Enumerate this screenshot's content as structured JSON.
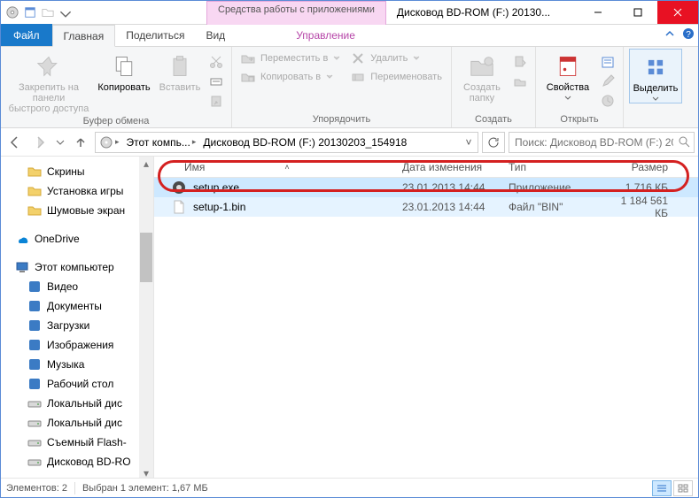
{
  "titlebar": {
    "context_tab": "Средства работы с приложениями",
    "title": "Дисковод BD-ROM (F:) 20130..."
  },
  "tabs": {
    "file": "Файл",
    "home": "Главная",
    "share": "Поделиться",
    "view": "Вид",
    "manage": "Управление"
  },
  "ribbon": {
    "pin": "Закрепить на панели\nбыстрого доступа",
    "copy": "Копировать",
    "paste": "Вставить",
    "clipboard_group": "Буфер обмена",
    "move_to": "Переместить в",
    "copy_to": "Копировать в",
    "delete": "Удалить",
    "rename": "Переименовать",
    "organize_group": "Упорядочить",
    "new_folder": "Создать\nпапку",
    "new_group": "Создать",
    "properties": "Свойства",
    "open_group": "Открыть",
    "select": "Выделить",
    "select_group": ""
  },
  "nav": {
    "crumb1": "Этот компь...",
    "crumb2": "Дисковод BD-ROM (F:) 20130203_154918",
    "search_placeholder": "Поиск: Дисковод BD-ROM (F:) 2013..."
  },
  "tree": {
    "items": [
      {
        "label": "Скрины",
        "icon": "folder",
        "depth": 1
      },
      {
        "label": "Установка игры",
        "icon": "folder",
        "depth": 1
      },
      {
        "label": "Шумовые экран",
        "icon": "folder",
        "depth": 1
      },
      {
        "label": "OneDrive",
        "icon": "onedrive",
        "depth": 0,
        "spacer_before": true
      },
      {
        "label": "Этот компьютер",
        "icon": "pc",
        "depth": 0,
        "spacer_before": true
      },
      {
        "label": "Видео",
        "icon": "video",
        "depth": 1
      },
      {
        "label": "Документы",
        "icon": "docs",
        "depth": 1
      },
      {
        "label": "Загрузки",
        "icon": "downloads",
        "depth": 1
      },
      {
        "label": "Изображения",
        "icon": "pictures",
        "depth": 1
      },
      {
        "label": "Музыка",
        "icon": "music",
        "depth": 1
      },
      {
        "label": "Рабочий стол",
        "icon": "desktop",
        "depth": 1
      },
      {
        "label": "Локальный дис",
        "icon": "drive",
        "depth": 1
      },
      {
        "label": "Локальный дис",
        "icon": "drive",
        "depth": 1
      },
      {
        "label": "Съемный Flash-",
        "icon": "usb",
        "depth": 1
      },
      {
        "label": "Дисковод BD-RO",
        "icon": "bdrom",
        "depth": 1
      }
    ]
  },
  "columns": {
    "name": "Имя",
    "date": "Дата изменения",
    "type": "Тип",
    "size": "Размер"
  },
  "files": [
    {
      "name": "setup.exe",
      "date": "23.01.2013 14:44",
      "type": "Приложение",
      "size": "1 716 КБ",
      "icon": "exe",
      "selected": true
    },
    {
      "name": "setup-1.bin",
      "date": "23.01.2013 14:44",
      "type": "Файл \"BIN\"",
      "size": "1 184 561 КБ",
      "icon": "bin",
      "selected": false,
      "hover": true
    }
  ],
  "status": {
    "count": "Элементов: 2",
    "sel": "Выбран 1 элемент: 1,67 МБ"
  }
}
